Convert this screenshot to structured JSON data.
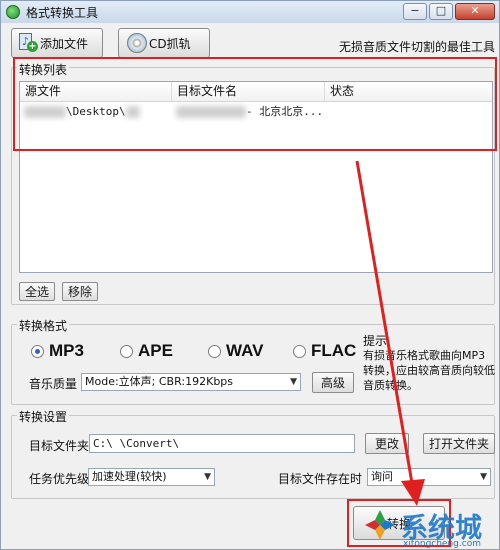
{
  "window": {
    "title": "格式转换工具",
    "minimize": "−",
    "restore": "□",
    "close": "✕"
  },
  "toolbar": {
    "add_file_label": "添加文件",
    "cd_rip_label": "CD抓轨",
    "tagline": "无损音质文件切割的最佳工具"
  },
  "convert_list": {
    "title": "转换列表",
    "columns": [
      "源文件",
      "目标文件名",
      "状态"
    ],
    "rows": [
      {
        "source": "\\Desktop\\",
        "target": "- 北京北京...",
        "status": ""
      }
    ],
    "select_all_label": "全选",
    "remove_label": "移除"
  },
  "format": {
    "title": "转换格式",
    "options": [
      "MP3",
      "APE",
      "WAV",
      "FLAC"
    ],
    "selected": "MP3",
    "quality_label": "音乐质量",
    "quality_value": "Mode:立体声; CBR:192Kbps",
    "advanced_label": "高级",
    "tip_title": "提示",
    "tip_text": "有损音乐格式歌曲向MP3转换，应由较高音质向较低音质转换。"
  },
  "settings": {
    "title": "转换设置",
    "target_folder_label": "目标文件夹",
    "target_folder_value": "C:\\        \\Convert\\",
    "change_label": "更改",
    "open_folder_label": "打开文件夹",
    "priority_label": "任务优先级",
    "priority_value": "加速处理(较快)",
    "exists_label": "目标文件存在时",
    "exists_value": "询问"
  },
  "start_button": {
    "label": "转换"
  },
  "watermark": {
    "text": "系统城",
    "url": "xitongcheng.com"
  },
  "colors": {
    "annotation_red": "#e02020",
    "radio_selected": "#2a67c4",
    "watermark_blue": "#1d78c8"
  }
}
